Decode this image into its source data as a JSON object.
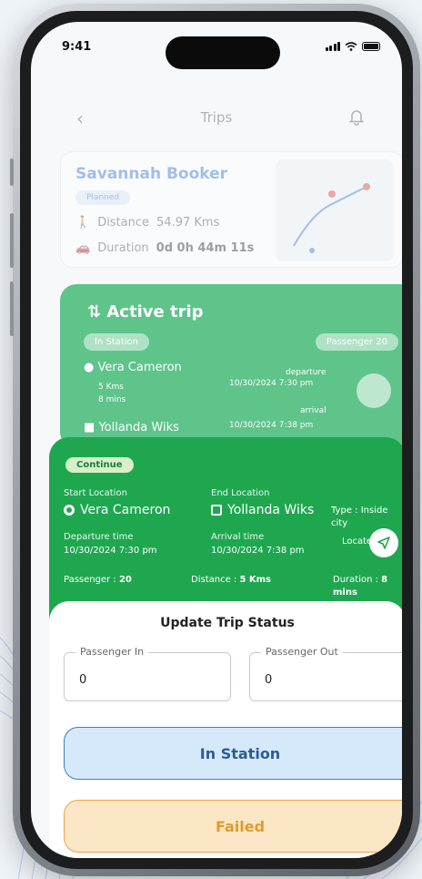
{
  "status_bar": {
    "time": "9:41"
  },
  "header": {
    "title": "Trips"
  },
  "planned_trip": {
    "name": "Savannah Booker",
    "status": "Planned",
    "distance_label": "Distance",
    "distance_value": "54.97 Kms",
    "duration_label": "Duration",
    "duration_value": "0d 0h 44m 11s"
  },
  "active_trip": {
    "title": "Active trip",
    "status": "In Station",
    "passenger": "Passenger 20",
    "from": "Vera Cameron",
    "to": "Yollanda Wiks",
    "distance": "5 Kms",
    "time": "8 mins",
    "departure_label": "departure",
    "departure_time": "10/30/2024 7:30 pm",
    "arrival_label": "arrival",
    "arrival_time": "10/30/2024 7:38 pm"
  },
  "trip_details": {
    "badge": "Continue",
    "start_label": "Start Location",
    "start_value": "Vera Cameron",
    "end_label": "End Location",
    "end_value": "Yollanda Wiks",
    "type": "Type : Inside city",
    "departure_label": "Departure time",
    "departure_value": "10/30/2024 7:30 pm",
    "arrival_label": "Arrival time",
    "arrival_value": "10/30/2024 7:38 pm",
    "locate_label": "Locate",
    "passenger_label": "Passenger : ",
    "passenger_value": "20",
    "distance_label": "Distance : ",
    "distance_value": "5 Kms",
    "duration_label": "Duration : ",
    "duration_value": "8 mins"
  },
  "update_status": {
    "title": "Update Trip Status",
    "passenger_in_label": "Passenger In",
    "passenger_in_value": "0",
    "passenger_out_label": "Passenger Out",
    "passenger_out_value": "0",
    "in_station_button": "In Station",
    "failed_button": "Failed"
  },
  "colors": {
    "primary_green": "#1fa750",
    "active_green": "#5ec48a",
    "in_station_blue": "#d5e9fa",
    "failed_orange": "#fbe7c6"
  }
}
